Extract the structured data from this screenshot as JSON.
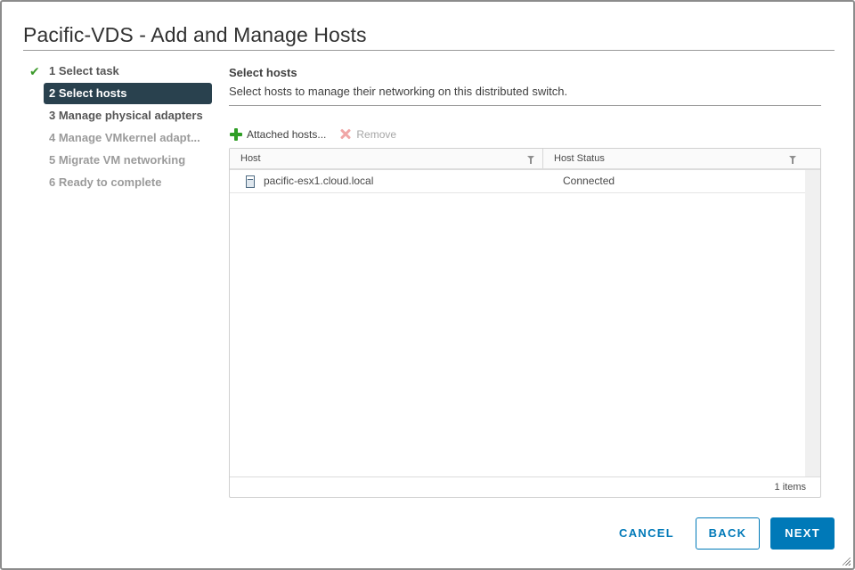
{
  "dialog": {
    "title": "Pacific-VDS - Add and Manage Hosts"
  },
  "steps": [
    {
      "label": "1 Select task",
      "state": "completed"
    },
    {
      "label": "2 Select hosts",
      "state": "active"
    },
    {
      "label": "3 Manage physical adapters",
      "state": "enabled"
    },
    {
      "label": "4 Manage VMkernel adapt...",
      "state": "disabled"
    },
    {
      "label": "5 Migrate VM networking",
      "state": "disabled"
    },
    {
      "label": "6 Ready to complete",
      "state": "disabled"
    }
  ],
  "content": {
    "title": "Select hosts",
    "description": "Select hosts to manage their networking on this distributed switch."
  },
  "toolbar": {
    "attached_hosts_label": "Attached hosts...",
    "attached_hosts_icon": "plus-icon",
    "remove_label": "Remove",
    "remove_icon": "x-icon",
    "remove_enabled": false
  },
  "grid": {
    "columns": [
      "Host",
      "Host Status"
    ],
    "rows": [
      {
        "host": "pacific-esx1.cloud.local",
        "icon": "host-icon",
        "status": "Connected"
      }
    ],
    "footer": "1 items"
  },
  "footer": {
    "cancel_label": "CANCEL",
    "back_label": "BACK",
    "next_label": "NEXT"
  },
  "colors": {
    "accent": "#0079b8",
    "active_step_bg": "#29414e",
    "check_green": "#3c9a2a"
  }
}
